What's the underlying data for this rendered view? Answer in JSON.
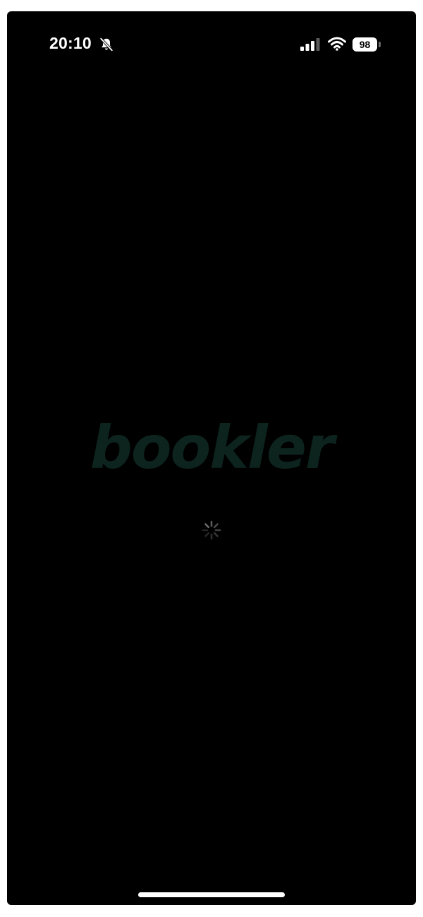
{
  "status_bar": {
    "time": "20:10",
    "battery_level": "98",
    "icons": [
      "bell-slash-icon",
      "cellular-signal-icon",
      "wifi-icon",
      "battery-icon"
    ]
  },
  "splash": {
    "logo_text": "bookler",
    "loading_indicator": "spinner-icon"
  },
  "colors": {
    "background": "#000000",
    "logo": "#0d241e",
    "status_text": "#ffffff"
  }
}
